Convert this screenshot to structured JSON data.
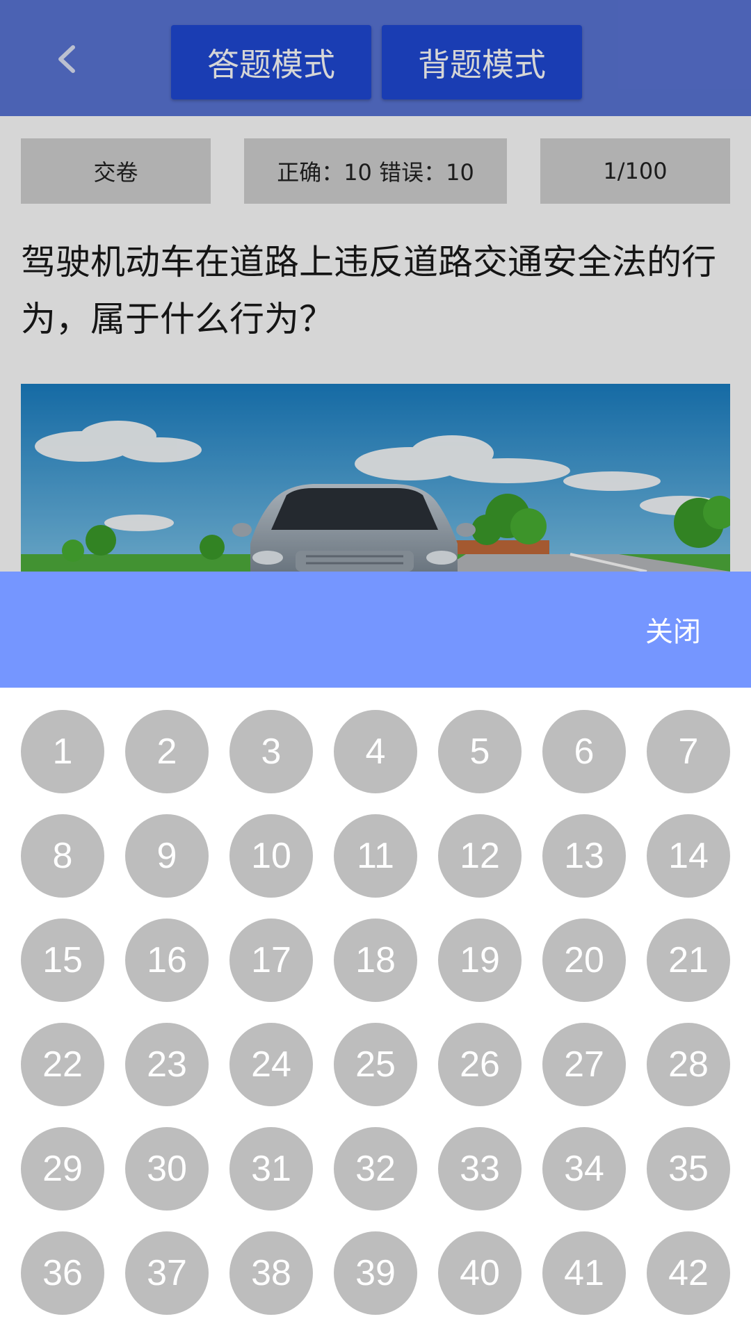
{
  "header": {
    "back_icon": "chevron-left-icon",
    "mode_answer_label": "答题模式",
    "mode_recite_label": "背题模式"
  },
  "stats": {
    "submit_label": "交卷",
    "score_text": "正确：10 错误：10",
    "progress_text": "1/100"
  },
  "question": {
    "text": "驾驶机动车在道路上违反道路交通安全法的行为，属于什么行为？"
  },
  "sheet": {
    "close_label": "关闭",
    "numbers": [
      "1",
      "2",
      "3",
      "4",
      "5",
      "6",
      "7",
      "8",
      "9",
      "10",
      "11",
      "12",
      "13",
      "14",
      "15",
      "16",
      "17",
      "18",
      "19",
      "20",
      "21",
      "22",
      "23",
      "24",
      "25",
      "26",
      "27",
      "28",
      "29",
      "30",
      "31",
      "32",
      "33",
      "34",
      "35",
      "36",
      "37",
      "38",
      "39",
      "40",
      "41",
      "42"
    ]
  },
  "colors": {
    "topbar": "#5a75d6",
    "mode_button": "#1f49d6",
    "sheet_header": "#7596ff",
    "number_circle": "#bdbdbd"
  }
}
